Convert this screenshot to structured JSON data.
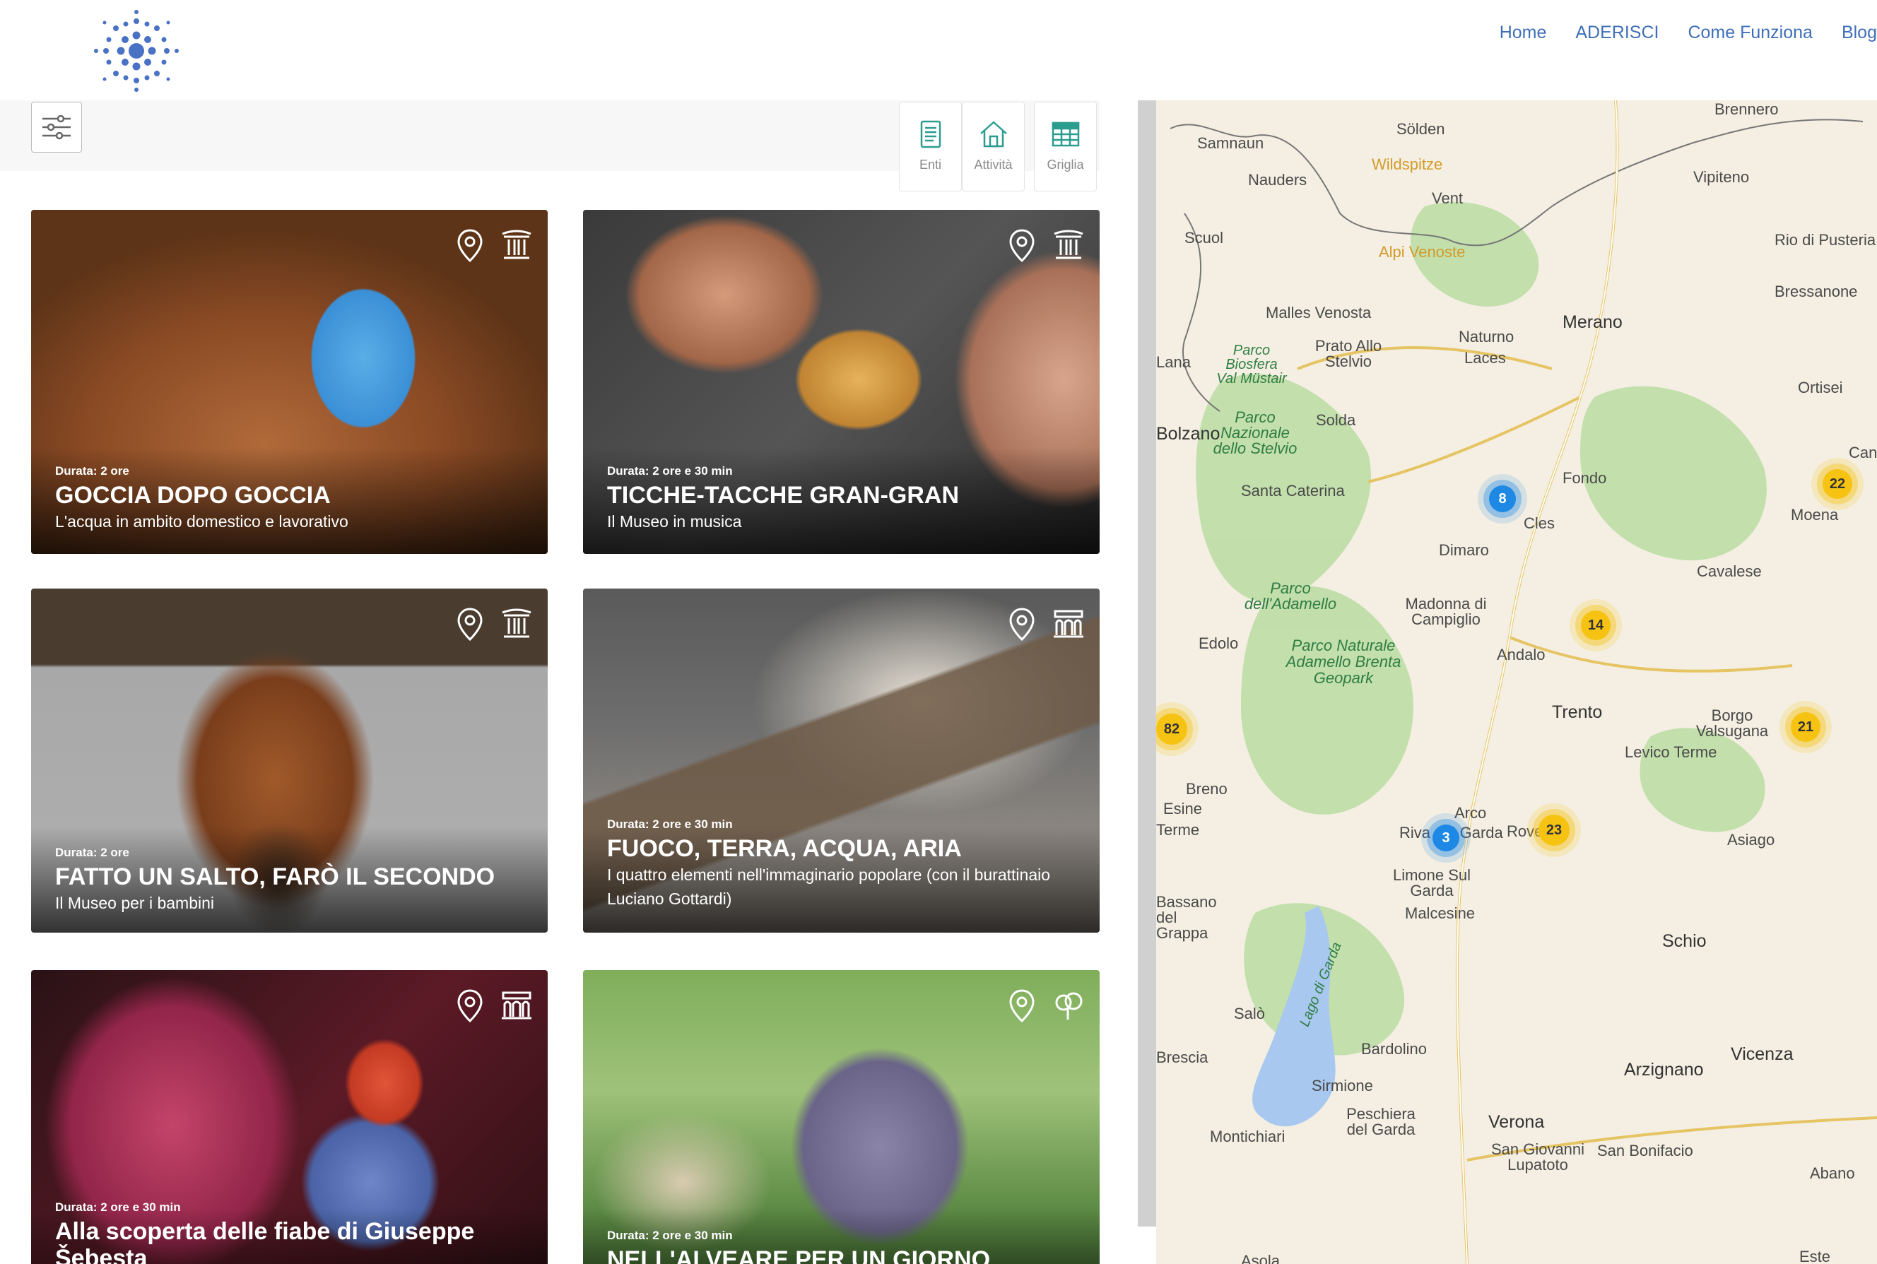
{
  "nav": {
    "items": [
      {
        "label": "Home"
      },
      {
        "label": "ADERISCI"
      },
      {
        "label": "Come Funziona"
      },
      {
        "label": "Blog"
      }
    ]
  },
  "views": {
    "enti": "Enti",
    "attivita": "Attività",
    "griglia": "Griglia"
  },
  "cards": [
    {
      "duration": "Durata: 2 ore",
      "title": "GOCCIA DOPO GOCCIA",
      "subtitle": "L'acqua in ambito domestico e lavorativo"
    },
    {
      "duration": "Durata: 2 ore e 30 min",
      "title": "TICCHE-TACCHE GRAN-GRAN",
      "subtitle": "Il Museo in musica"
    },
    {
      "duration": "Durata: 2 ore",
      "title": "FATTO UN SALTO, FARÒ IL SECONDO",
      "subtitle": "Il Museo per i bambini"
    },
    {
      "duration": "Durata: 2 ore e 30 min",
      "title": "FUOCO, TERRA, ACQUA, ARIA",
      "subtitle": "I quattro elementi nell'immaginario popolare (con il burattinaio Luciano Gottardi)"
    },
    {
      "duration": "Durata: 2 ore e 30 min",
      "title": "Alla scoperta delle fiabe di Giuseppe Šebesta",
      "subtitle": ""
    },
    {
      "duration": "Durata: 2 ore e 30 min",
      "title": "NELL'ALVEARE PER UN GIORNO",
      "subtitle": ""
    }
  ],
  "map": {
    "places": [
      "Samnaun",
      "Nauders",
      "Sölden",
      "Vent",
      "Vipiteno",
      "Brennero",
      "Scuol",
      "Wildspitze",
      "Alpi Venoste",
      "Malles Venosta",
      "Prato Allo Stelvio",
      "Naturno",
      "Merano",
      "Laces",
      "Lana",
      "Rio di Pusteria",
      "Bressanone",
      "Ortisei",
      "Parco Biosfera Val Müstair",
      "Parco Nazionale dello Stelvio",
      "Solda",
      "Bolzano",
      "Santa Caterina",
      "Fondo",
      "Moena",
      "Cles",
      "Dimaro",
      "Cavalese",
      "Parco dell'Adamello",
      "Madonna di Campiglio",
      "Edolo",
      "Parco Naturale Adamello Brenta Geopark",
      "Andalo",
      "Trento",
      "Borgo Valsugana",
      "Levico Terme",
      "Breno",
      "Esine",
      "Terme",
      "Arco",
      "Riva del Garda",
      "Rovereto",
      "Asiago",
      "Limone Sul Garda",
      "Malcesine",
      "Schio",
      "Bassano del Grappa",
      "Lago di Garda",
      "Salò",
      "Bardolino",
      "Arzignano",
      "Vicenza",
      "Sirmione",
      "Peschiera del Garda",
      "Verona",
      "Montichiari",
      "San Giovanni Lupatoto",
      "San Bonifacio",
      "Abano",
      "Este",
      "Asola",
      "Canazei",
      "Brescia"
    ],
    "clusters": [
      {
        "label": "8",
        "kind": "blue"
      },
      {
        "label": "22",
        "kind": "yellow"
      },
      {
        "label": "14",
        "kind": "yellow"
      },
      {
        "label": "82",
        "kind": "yellow"
      },
      {
        "label": "21",
        "kind": "yellow"
      },
      {
        "label": "3",
        "kind": "blue"
      },
      {
        "label": "23",
        "kind": "yellow"
      }
    ]
  },
  "colors": {
    "nav": "#3f6fb8",
    "icon_teal": "#2a9d8f",
    "cluster_blue": "#1e88e5",
    "cluster_yellow": "#f6c313"
  }
}
